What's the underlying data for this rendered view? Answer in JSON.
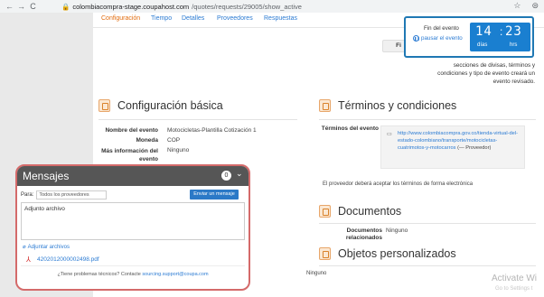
{
  "browser": {
    "back_icon": "←",
    "forward_icon": "→",
    "reload_icon": "C",
    "url_host": "colombiacompra-stage.coupahost.com",
    "url_path": "/quotes/requests/29005/show_active"
  },
  "tabs": [
    {
      "label": "Configuración",
      "active": true
    },
    {
      "label": "Tiempo",
      "active": false
    },
    {
      "label": "Detalles",
      "active": false
    },
    {
      "label": "Proveedores",
      "active": false
    },
    {
      "label": "Respuestas",
      "active": false
    }
  ],
  "timer": {
    "label": "Fin del evento",
    "pause": "pausar el evento",
    "days": "14",
    "hours": "23",
    "days_label": "días",
    "hours_label": "hrs"
  },
  "partial_button": "Fi",
  "info_text": "secciones de divisas, términos y condiciones y tipo de evento creará un evento revisado.",
  "config": {
    "title": "Configuración básica",
    "rows": [
      {
        "label": "Nombre del evento",
        "value": "Motocicletas-Plantilla Cotización 1"
      },
      {
        "label": "Moneda",
        "value": "COP"
      },
      {
        "label": "Más información del evento",
        "value": "Ninguno"
      }
    ]
  },
  "terms": {
    "title": "Términos y condiciones",
    "label": "Términos del evento",
    "link": "http://www.colombiacompra.gov.co/tienda-virtual-del-estado-colombiano/transporte/motocicletas-cuatrimotos-y-motocarros",
    "provider": "(— Proveedor)",
    "note": "El proveedor deberá aceptar los términos de forma electrónica"
  },
  "documents": {
    "title": "Documentos",
    "label": "Documentos relacionados",
    "value": "Ninguno"
  },
  "custom_objects": {
    "title": "Objetos personalizados",
    "value": "Ninguno"
  },
  "messages": {
    "title": "Mensajes",
    "count": "0",
    "to_label": "Para:",
    "to_value": "Todos los proveedores",
    "send": "Enviar un mensaje",
    "body": "Adjunto archivo",
    "attach": "Adjuntar archivos",
    "file": "4202012000002498.pdf",
    "help_prefix": "¿Tiene problemas técnicos? Contacte",
    "help_link": "sourcing.support@coupa.com"
  },
  "watermark": {
    "line1": "Activate Wi",
    "line2": "Go to Settings t"
  },
  "colors": {
    "accent": "#2b7bd3",
    "tab_active": "#e26c0e",
    "timer_bg": "#1a7fd0",
    "messages_header": "#565656",
    "highlight_border": "#d46a6a"
  }
}
